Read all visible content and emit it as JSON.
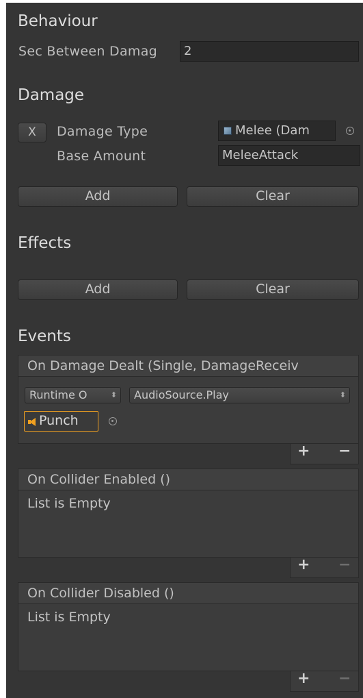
{
  "behaviour": {
    "heading": "Behaviour",
    "sec_between_label": "Sec Between Damag",
    "sec_between_value": "2"
  },
  "damage": {
    "heading": "Damage",
    "remove_label": "X",
    "damage_type_label": "Damage Type",
    "damage_type_value": "Melee (Dam",
    "base_amount_label": "Base Amount",
    "base_amount_value": "MeleeAttack",
    "add_label": "Add",
    "clear_label": "Clear"
  },
  "effects": {
    "heading": "Effects",
    "add_label": "Add",
    "clear_label": "Clear"
  },
  "events": {
    "heading": "Events",
    "on_damage_dealt": {
      "title": "On Damage Dealt (Single, DamageReceiv",
      "runtime_option": "Runtime O",
      "function": "AudioSource.Play",
      "object": "Punch"
    },
    "on_collider_enabled": {
      "title": "On Collider Enabled ()",
      "empty_text": "List is Empty"
    },
    "on_collider_disabled": {
      "title": "On Collider Disabled ()",
      "empty_text": "List is Empty"
    },
    "plus": "+",
    "minus": "−"
  },
  "colors": {
    "panel": "#353535",
    "field": "#2a2a2a",
    "button": "#444444",
    "audio_icon": "#f0a020"
  }
}
